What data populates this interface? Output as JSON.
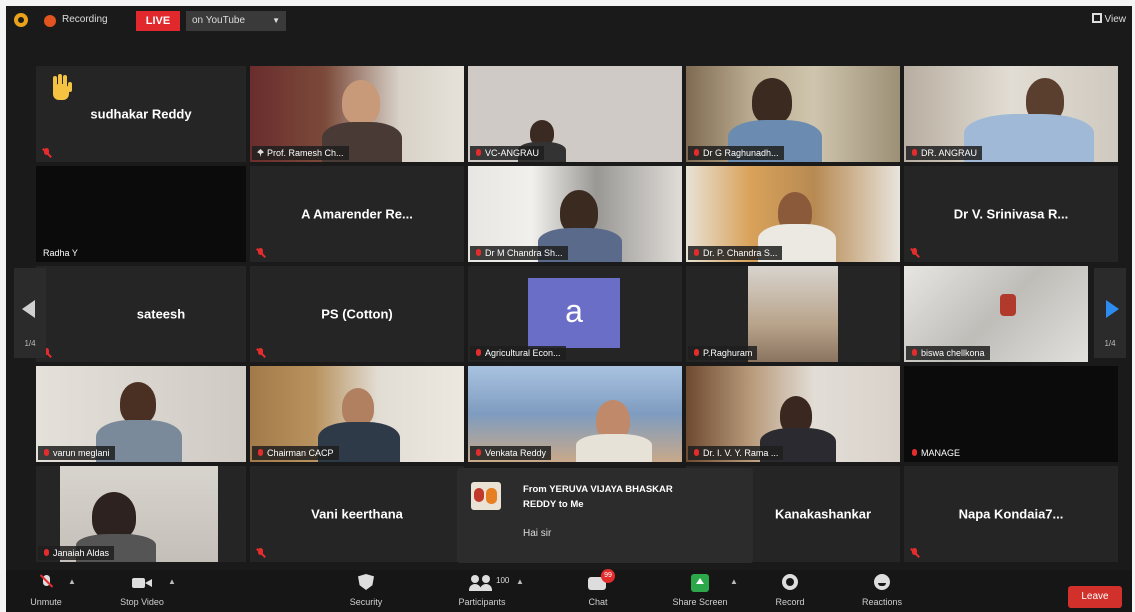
{
  "topbar": {
    "recording_label": "Recording",
    "live_badge": "LIVE",
    "stream_target": "on YouTube",
    "view_label": "View"
  },
  "pagination": {
    "left_page": "1/4",
    "right_page": "1/4"
  },
  "tiles": {
    "t00": {
      "name": "sudhakar Reddy"
    },
    "t01": {
      "name": "Prof. Ramesh Ch..."
    },
    "t02": {
      "name": "VC-ANGRAU"
    },
    "t03": {
      "name": "Dr G Raghunadh..."
    },
    "t04": {
      "name": "DR. ANGRAU"
    },
    "t10": {
      "name": "Radha Y"
    },
    "t11": {
      "name": "A Amarender Re..."
    },
    "t12": {
      "name": "Dr M Chandra Sh..."
    },
    "t13": {
      "name": "Dr. P. Chandra S..."
    },
    "t14": {
      "name": "Dr V. Srinivasa R..."
    },
    "t20": {
      "name": "sateesh"
    },
    "t21": {
      "name": "PS (Cotton)"
    },
    "t22": {
      "name": "Agricultural Econ...",
      "avatar_letter": "a"
    },
    "t23": {
      "name": "P.Raghuram"
    },
    "t24": {
      "name": "biswa chellkona"
    },
    "t30": {
      "name": "varun meglani"
    },
    "t31": {
      "name": "Chairman CACP"
    },
    "t32": {
      "name": "Venkata Reddy"
    },
    "t33": {
      "name": "Dr. I. V. Y. Rama ..."
    },
    "t34": {
      "name": "MANAGE"
    },
    "t40": {
      "name": "Janaiah Aldas"
    },
    "t41": {
      "name": "Vani keerthana"
    },
    "t43": {
      "name": "Kanakashankar"
    },
    "t44": {
      "name": "Napa Kondaia7..."
    }
  },
  "chat_popup": {
    "from": "From YERUVA VIJAYA BHASKAR REDDY to Me",
    "message": "Hai sir"
  },
  "toolbar": {
    "unmute": "Unmute",
    "stop_video": "Stop Video",
    "security": "Security",
    "participants": "Participants",
    "participants_count": "100",
    "chat": "Chat",
    "chat_badge": "99",
    "share_screen": "Share Screen",
    "record": "Record",
    "reactions": "Reactions",
    "leave": "Leave"
  },
  "colors": {
    "background": "#1a1a1a",
    "tile": "#252525",
    "active_speaker_border": "#b7df5d",
    "live_red": "#e0282d",
    "muted_red": "#e32d2d",
    "share_green": "#2ca84a",
    "next_arrow_blue": "#2d8cf0",
    "avatar_purple": "#6b6ec6"
  },
  "icons": {
    "raise_hand": "raised-hand-icon",
    "muted": "mic-muted-icon",
    "pinned": "pin-icon"
  }
}
